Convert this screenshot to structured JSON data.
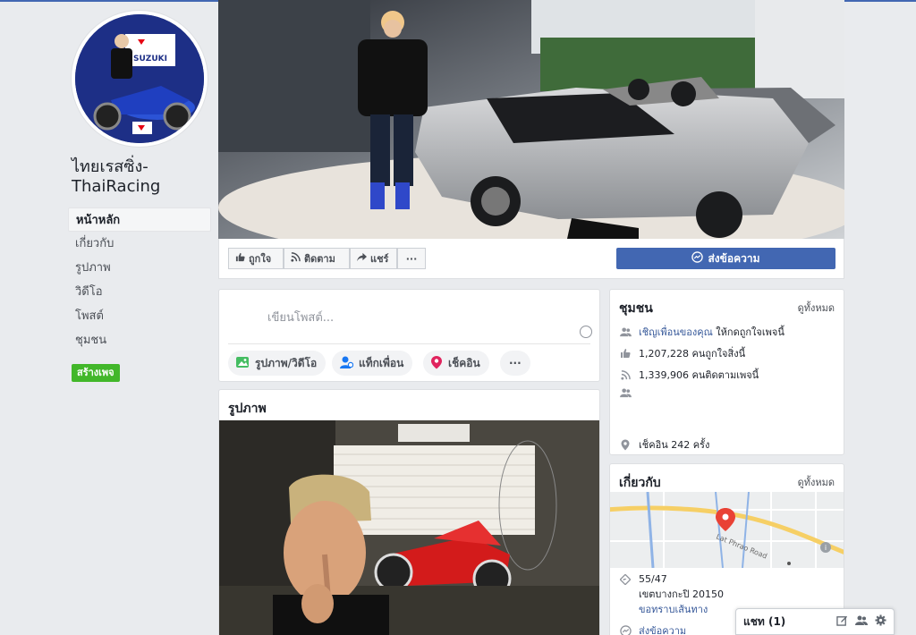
{
  "page": {
    "name": "ไทยเรสซิ่ง-ThaiRacing",
    "avatar_brand": "SUZUKI"
  },
  "nav": [
    {
      "label": "หน้าหลัก",
      "active": true
    },
    {
      "label": "เกี่ยวกับ"
    },
    {
      "label": "รูปภาพ"
    },
    {
      "label": "วิดีโอ"
    },
    {
      "label": "โพสต์"
    },
    {
      "label": "ชุมชน"
    }
  ],
  "create_page": "สร้างเพจ",
  "actions": {
    "like": "ถูกใจ",
    "follow": "ติดตาม",
    "share": "แชร์",
    "more": "···",
    "message": "ส่งข้อความ"
  },
  "composer": {
    "placeholder": "เขียนโพสต์...",
    "photo_video": "รูปภาพ/วิดีโอ",
    "tag_friends": "แท็กเพื่อน",
    "check_in": "เช็คอิน",
    "more": "···"
  },
  "photos": {
    "title": "รูปภาพ"
  },
  "community": {
    "title": "ชุมชน",
    "see_all": "ดูทั้งหมด",
    "invite_link": "เชิญเพื่อนของคุณ",
    "invite_rest": "ให้กดถูกใจเพจนี้",
    "likes": "1,207,228 คนถูกใจสิ่งนี้",
    "follows": "1,339,906 คนติดตามเพจนี้",
    "checkins": "เช็คอิน 242 ครั้ง"
  },
  "about": {
    "title": "เกี่ยวกับ",
    "see_all": "ดูทั้งหมด",
    "map_road": "Lat Phrao Road",
    "address_line1": "55/47",
    "address_line2": "เขตบางกะปิ 20150",
    "directions": "ขอทราบเส้นทาง",
    "send_message": "ส่งข้อความ"
  },
  "chat": {
    "label": "แชท (1)"
  },
  "colors": {
    "brand_blue": "#4267b2",
    "link_blue": "#365899",
    "green": "#42b72a",
    "background": "#e9ebee"
  }
}
